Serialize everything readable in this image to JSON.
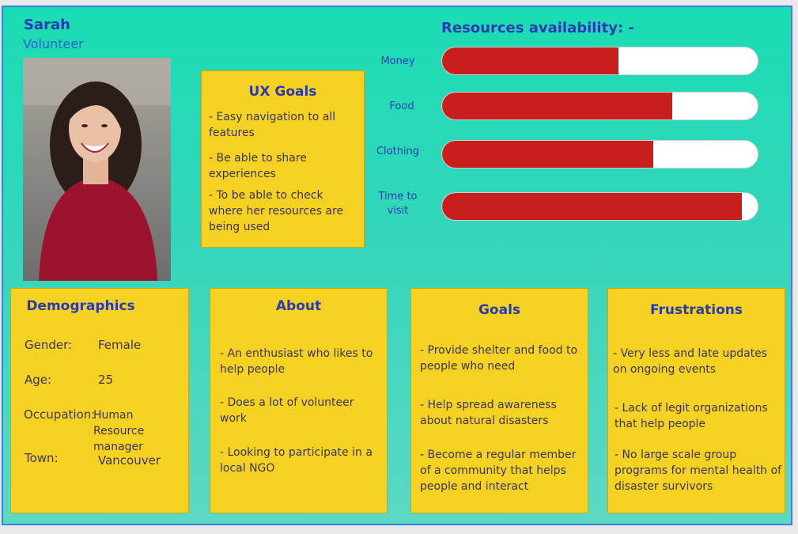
{
  "persona": {
    "name": "Sarah",
    "role": "Volunteer"
  },
  "ux_goals": {
    "title": "UX Goals",
    "items": [
      "- Easy navigation to all features",
      "- Be able to share experiences",
      "- To be able to check where her resources are being used"
    ]
  },
  "resources": {
    "title": "Resources availability: -",
    "items": [
      {
        "label": "Money",
        "level": 0.56
      },
      {
        "label": "Food",
        "level": 0.73
      },
      {
        "label": "Clothing",
        "level": 0.67
      },
      {
        "label": "Time to visit",
        "level": 0.95
      }
    ],
    "fill_color": "#c91e1e"
  },
  "demographics": {
    "title": "Demographics",
    "rows": [
      {
        "key": "Gender:",
        "value": "Female"
      },
      {
        "key": "Age:",
        "value": "25"
      },
      {
        "key": "Occupation:",
        "value": "Human Resource manager"
      },
      {
        "key": "Town:",
        "value": "Vancouver"
      }
    ]
  },
  "about": {
    "title": "About",
    "items": [
      "- An enthusiast who likes to help people",
      "- Does a lot of volunteer work",
      "- Looking to participate in a local NGO"
    ]
  },
  "goals": {
    "title": "Goals",
    "items": [
      "- Provide shelter and food to people who need",
      "- Help spread awareness about natural disasters",
      "- Become a regular member of a community that helps people and interact"
    ]
  },
  "frustrations": {
    "title": "Frustrations",
    "items": [
      "- Very less and late updates on ongoing events",
      "- Lack of legit organizations that help people",
      "- No large scale group programs for mental health of disaster survivors"
    ]
  },
  "colors": {
    "card": "#f5d222",
    "title": "#2a3bb0",
    "border": "#3b7fe6"
  }
}
